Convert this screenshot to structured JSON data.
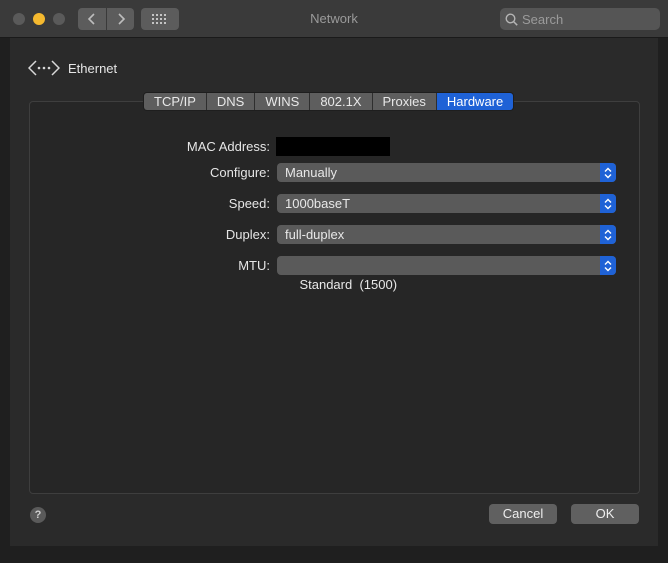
{
  "window": {
    "title": "Network"
  },
  "search": {
    "placeholder": "Search"
  },
  "header": {
    "label": "Ethernet"
  },
  "tabs": [
    "TCP/IP",
    "DNS",
    "WINS",
    "802.1X",
    "Proxies",
    "Hardware"
  ],
  "active_tab": "Hardware",
  "fields": {
    "mac_label": "MAC Address:",
    "configure_label": "Configure:",
    "configure_value": "Manually",
    "speed_label": "Speed:",
    "speed_value": "1000baseT",
    "duplex_label": "Duplex:",
    "duplex_value": "full-duplex",
    "mtu_label": "MTU:",
    "mtu_value": "Standard  (1500)"
  },
  "footer": {
    "help": "?",
    "cancel": "Cancel",
    "ok": "OK"
  },
  "colors": {
    "accent": "#1f62d6",
    "minimize": "#f5b92f"
  }
}
